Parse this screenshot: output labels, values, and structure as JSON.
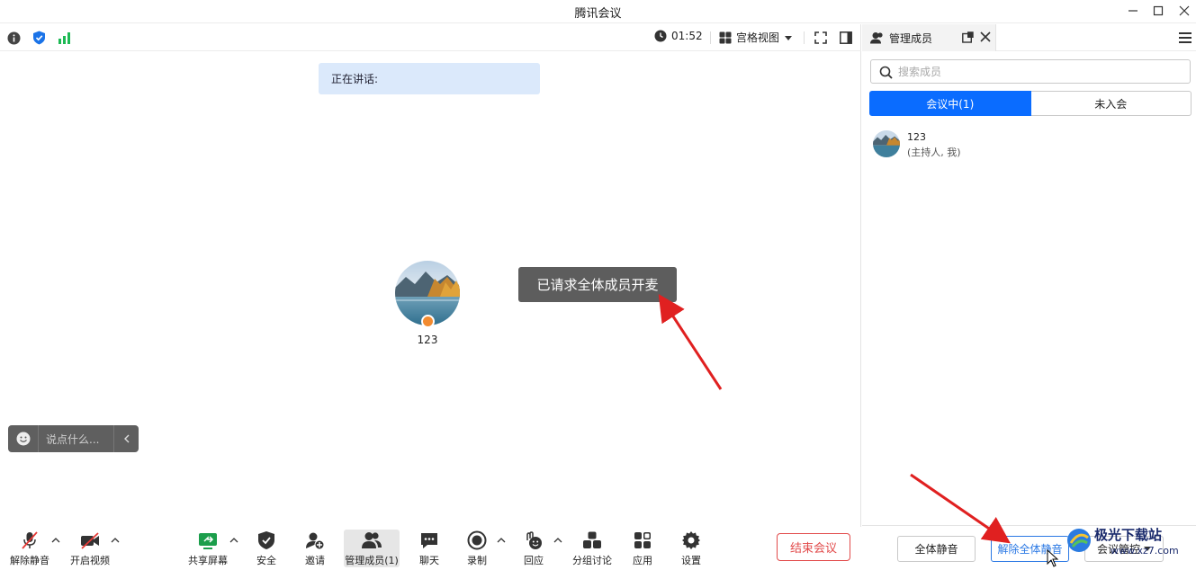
{
  "window": {
    "title": "腾讯会议"
  },
  "topbar": {
    "timer": "01:52",
    "view_mode": "宫格视图"
  },
  "stage": {
    "speaking_label": "正在讲话:",
    "participant_name": "123",
    "toast": "已请求全体成员开麦",
    "chat_placeholder": "说点什么..."
  },
  "toolbar": {
    "unmute": "解除静音",
    "start_video": "开启视频",
    "share_screen": "共享屏幕",
    "security": "安全",
    "invite": "邀请",
    "manage_members": "管理成员(1)",
    "chat": "聊天",
    "record": "录制",
    "reactions": "回应",
    "breakout": "分组讨论",
    "apps": "应用",
    "settings": "设置",
    "end_meeting": "结束会议"
  },
  "panel": {
    "title": "管理成员",
    "search_placeholder": "搜索成员",
    "tabs": [
      "会议中(1)",
      "未入会"
    ],
    "members": [
      {
        "name": "123",
        "role": "(主持人, 我)"
      }
    ],
    "mute_all": "全体静音",
    "unmute_all": "解除全体静音",
    "meeting_control": "会议管控"
  },
  "watermark": {
    "text": "极光下载站",
    "url": "www.xz7.com"
  },
  "colors": {
    "accent": "#0a6cff",
    "danger": "#e24b4b",
    "annotation_arrow": "#e02020"
  }
}
